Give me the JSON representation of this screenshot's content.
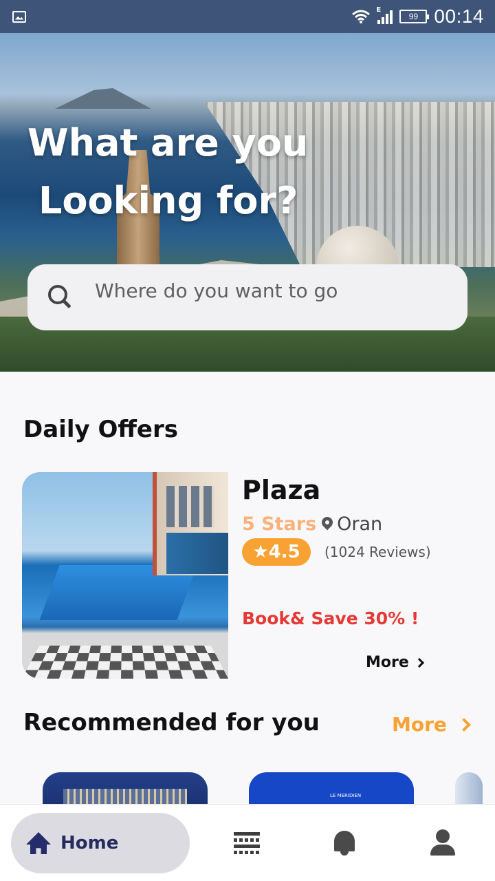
{
  "status_bar": {
    "time": "00:14",
    "battery": "99",
    "network": "E"
  },
  "hero": {
    "title_line1": "What are you",
    "title_line2": "Looking for?",
    "search_placeholder": "Where do you want to go"
  },
  "daily_offers": {
    "title": "Daily Offers",
    "offer": {
      "name": "Plaza",
      "stars": "5 Stars",
      "city": "Oran",
      "rating": "★4.5",
      "reviews": "(1024 Reviews)",
      "deal": "Book& Save 30% !",
      "more_label": "More"
    }
  },
  "recommended": {
    "title": "Recommended for you",
    "more_label": "More"
  },
  "bottom_nav": {
    "home_label": "Home",
    "items": [
      "home-icon",
      "list-icon",
      "bell-icon",
      "profile-icon"
    ]
  },
  "colors": {
    "accent_orange": "#f7a233",
    "stars_orange": "#f8b27a",
    "deal_red": "#e53935",
    "nav_active_bg": "#dcdbe2",
    "status_bar": "#3e5478"
  }
}
